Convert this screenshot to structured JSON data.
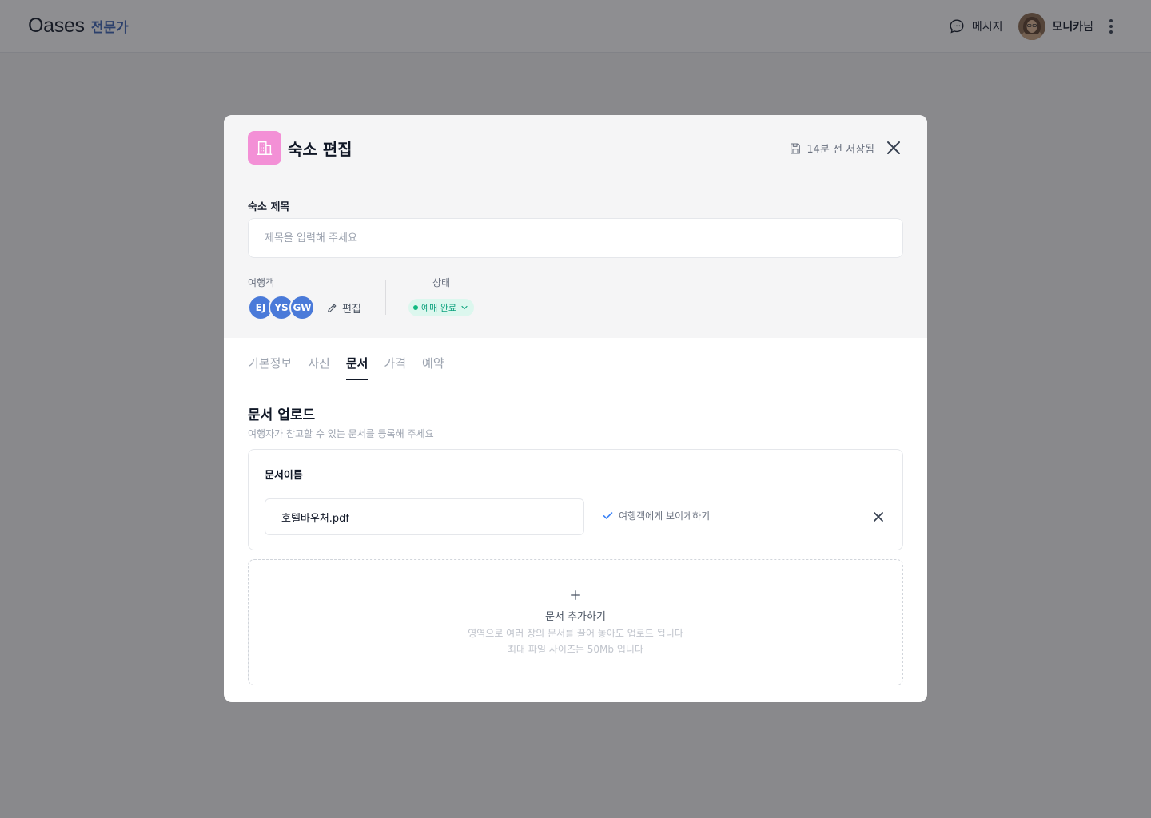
{
  "header": {
    "brand": "Oases",
    "brand_tag": "전문가",
    "messages_label": "메시지",
    "user_name": "모니카",
    "user_suffix": "님"
  },
  "modal": {
    "title": "숙소 편집",
    "saved_status": "14분 전 저장됨",
    "title_field": {
      "label": "숙소 제목",
      "value": "",
      "placeholder": "제목을 입력해 주세요"
    },
    "travelers": {
      "label": "여행객",
      "avatars": [
        "EJ",
        "YS",
        "GW"
      ],
      "edit_label": "편집"
    },
    "status": {
      "label": "상태",
      "value": "예매 완료"
    },
    "tabs": [
      {
        "label": "기본정보"
      },
      {
        "label": "사진"
      },
      {
        "label": "문서",
        "active": true
      },
      {
        "label": "가격"
      },
      {
        "label": "예약"
      }
    ],
    "documents": {
      "section_title": "문서 업로드",
      "section_subtitle": "여행자가 참고할 수 있는 문서를 등록해 주세요",
      "name_label": "문서이름",
      "items": [
        {
          "name": "호텔바우처.pdf",
          "visibility_label": "여행객에게 보이게하기",
          "visible": true
        }
      ],
      "dropzone": {
        "title": "문서 추가하기",
        "hint_line1": "영역으로 여러 장의 문서를 끌어 놓아도 업로드 됩니다",
        "hint_line2": "최대 파일 사이즈는 50Mb 입니다"
      }
    }
  },
  "colors": {
    "brand_tag": "#3b63b5",
    "hotel_icon_bg": "#f390d6",
    "avatar_bg": "#4a7ad9",
    "status_bg": "#dcf7ee",
    "status_text": "#10a37f",
    "check": "#3b82f6"
  }
}
